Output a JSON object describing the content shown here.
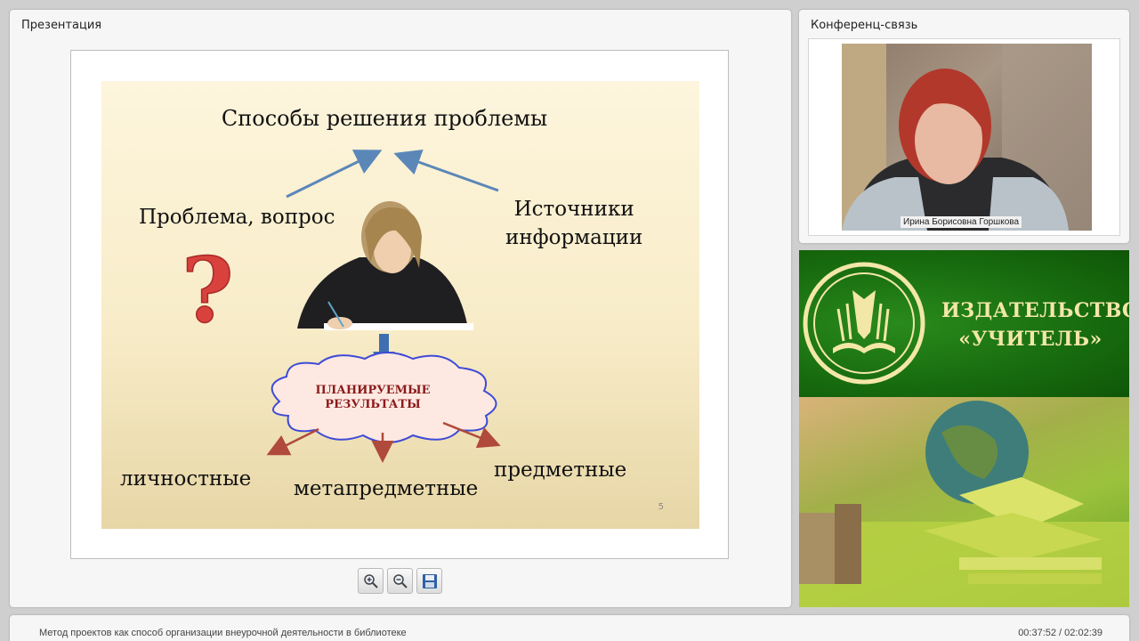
{
  "presentation": {
    "title": "Презентация",
    "slide": {
      "title": "Способы решения проблемы",
      "problem": "Проблема, вопрос",
      "sources_line1": "Источники",
      "sources_line2": "информации",
      "cloud_line1": "ПЛАНИРУЕМЫЕ",
      "cloud_line2": "РЕЗУЛЬТАТЫ",
      "result_personal": "личностные",
      "result_meta": "метапредметные",
      "result_subject": "предметные",
      "page_number": "5"
    },
    "toolbar": {
      "zoom_in_icon": "zoom-in-icon",
      "zoom_out_icon": "zoom-out-icon",
      "save_icon": "floppy-disk-icon"
    }
  },
  "conference": {
    "title": "Конференц-связь",
    "speaker_name": "Ирина Борисовна Горшкова"
  },
  "ad": {
    "publisher_line1": "ИЗДАТЕЛЬСТВО",
    "publisher_line2": "«УЧИТЕЛЬ»"
  },
  "status_bar": {
    "lecture_title": "Метод проектов как способ организации внеурочной деятельности в библиотеке",
    "time": "00:37:52 / 02:02:39"
  },
  "colors": {
    "arrow_blue": "#5b87b8",
    "arrow_red": "#b04a3c",
    "question_red": "#d8413c",
    "cloud_text": "#8b1a1a",
    "ad_green": "#176b0e",
    "ad_gold": "#f3e7a8"
  }
}
